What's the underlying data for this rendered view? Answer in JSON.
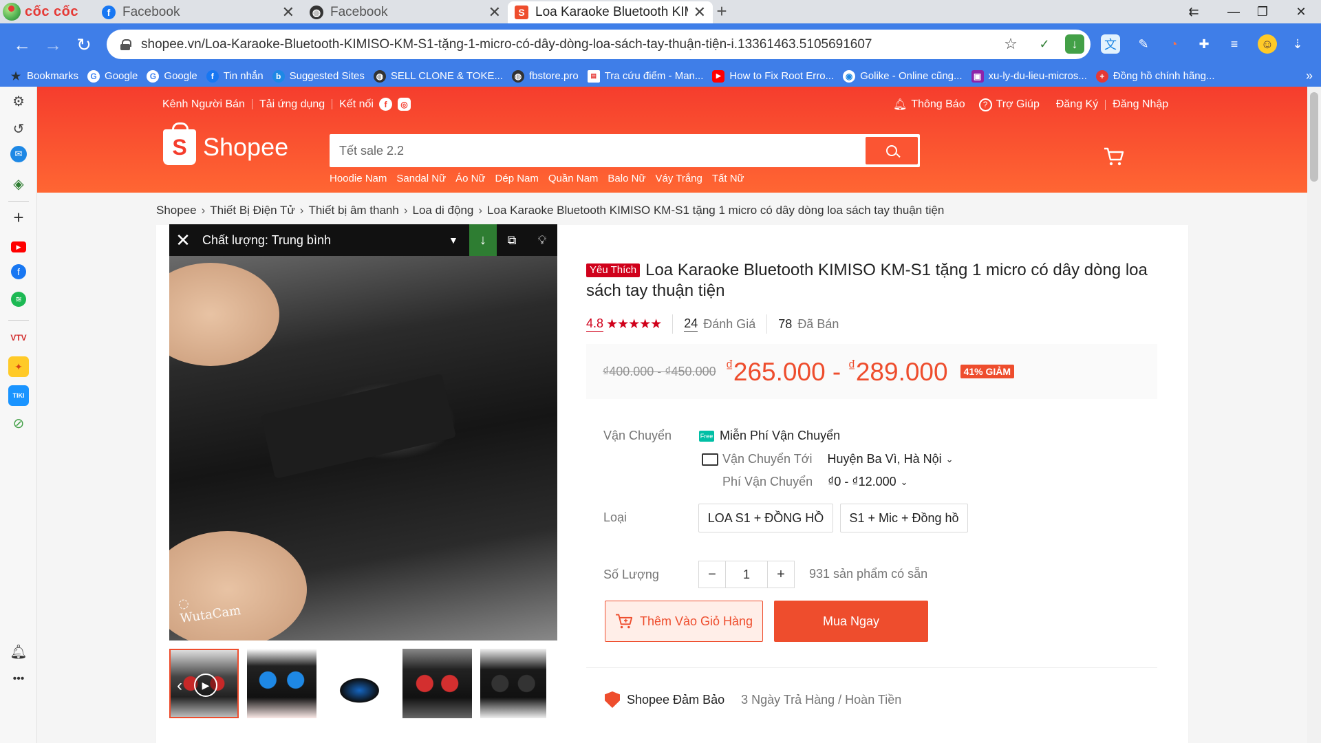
{
  "browser": {
    "brand": "cốc cốc",
    "tabs": [
      {
        "title": "Facebook",
        "favicon": "facebook-icon",
        "active": false
      },
      {
        "title": "Facebook",
        "favicon": "globe-icon",
        "active": false
      },
      {
        "title": "Loa Karaoke Bluetooth KIMISO",
        "favicon": "shopee-icon",
        "active": true
      }
    ],
    "url": "shopee.vn/Loa-Karaoke-Bluetooth-KIMISO-KM-S1-tặng-1-micro-có-dây-dòng-loa-sách-tay-thuận-tiện-i.13361463.5105691607",
    "bookmarks": [
      {
        "label": "Bookmarks",
        "icon": "star-icon",
        "color": "#f5c518"
      },
      {
        "label": "Google",
        "icon": "google-icon",
        "color": "#4285f4"
      },
      {
        "label": "Google",
        "icon": "google-icon",
        "color": "#4285f4"
      },
      {
        "label": "Tin nhắn",
        "icon": "facebook-icon",
        "color": "#1877f2"
      },
      {
        "label": "Suggested Sites",
        "icon": "bing-icon",
        "color": "#1e88e5"
      },
      {
        "label": "SELL CLONE & TOKE...",
        "icon": "globe-icon",
        "color": "#333333"
      },
      {
        "label": "fbstore.pro",
        "icon": "globe-icon",
        "color": "#333333"
      },
      {
        "label": "Tra cứu điểm - Man...",
        "icon": "page-icon",
        "color": "#e53935"
      },
      {
        "label": "How to Fix Root Erro...",
        "icon": "youtube-icon",
        "color": "#ff0000"
      },
      {
        "label": "Golike - Online cũng...",
        "icon": "golike-icon",
        "color": "#1e88e5"
      },
      {
        "label": "xu-ly-du-lieu-micros...",
        "icon": "image-icon",
        "color": "#8e24aa"
      },
      {
        "label": "Đồng hồ chính hãng...",
        "icon": "swiss-icon",
        "color": "#e53935"
      }
    ]
  },
  "header": {
    "links_left": [
      "Kênh Người Bán",
      "Tải ứng dụng",
      "Kết nối"
    ],
    "links_right": [
      "Thông Báo",
      "Trợ Giúp",
      "Đăng Ký",
      "Đăng Nhập"
    ],
    "logo_text": "Shopee",
    "search_placeholder": "Tết sale 2.2",
    "quick_links": [
      "Hoodie Nam",
      "Sandal Nữ",
      "Áo Nữ",
      "Dép Nam",
      "Quần Nam",
      "Balo Nữ",
      "Váy Trắng",
      "Tất Nữ"
    ]
  },
  "breadcrumb": [
    "Shopee",
    "Thiết Bị Điện Tử",
    "Thiết bị âm thanh",
    "Loa di động",
    "Loa Karaoke Bluetooth KIMISO KM-S1 tặng 1 micro có dây dòng loa sách tay thuận tiện"
  ],
  "video": {
    "quality_label": "Chất lượng: Trung bình",
    "watermark": "WutaCam"
  },
  "product": {
    "badge": "Yêu Thích",
    "title": "Loa Karaoke Bluetooth KIMISO KM-S1 tặng 1 micro có dây dòng loa sách tay thuận tiện",
    "rating": "4.8",
    "stars": 5,
    "review_count": "24",
    "review_label": "Đánh Giá",
    "sold_count": "78",
    "sold_label": "Đã Bán",
    "price_old": "₫400.000 - ₫450.000",
    "currency": "₫",
    "price_low": "265.000",
    "price_sep": " - ",
    "price_high": "289.000",
    "discount": "41% GIẢM",
    "shipping_label": "Vận Chuyển",
    "free_ship": "Miễn Phí Vận Chuyển",
    "ship_to_label": "Vận Chuyển Tới",
    "ship_to": "Huyện Ba Vì, Hà Nội",
    "ship_fee_label": "Phí Vận Chuyển",
    "ship_fee": "₫0 - ₫12.000",
    "variant_label": "Loại",
    "variants": [
      "LOA S1 + ĐỒNG HỒ",
      "S1 + Mic + Đồng hồ"
    ],
    "qty_label": "Số Lượng",
    "qty_value": "1",
    "stock": "931 sản phẩm có sẵn",
    "add_to_cart": "Thêm Vào Giỏ Hàng",
    "buy_now": "Mua Ngay",
    "guarantee_label": "Shopee Đảm Bảo",
    "guarantee_text": "3 Ngày Trả Hàng / Hoàn Tiền"
  },
  "colors": {
    "shopee": "#ee4d2d",
    "chrome_blue": "#3f7ee8"
  }
}
